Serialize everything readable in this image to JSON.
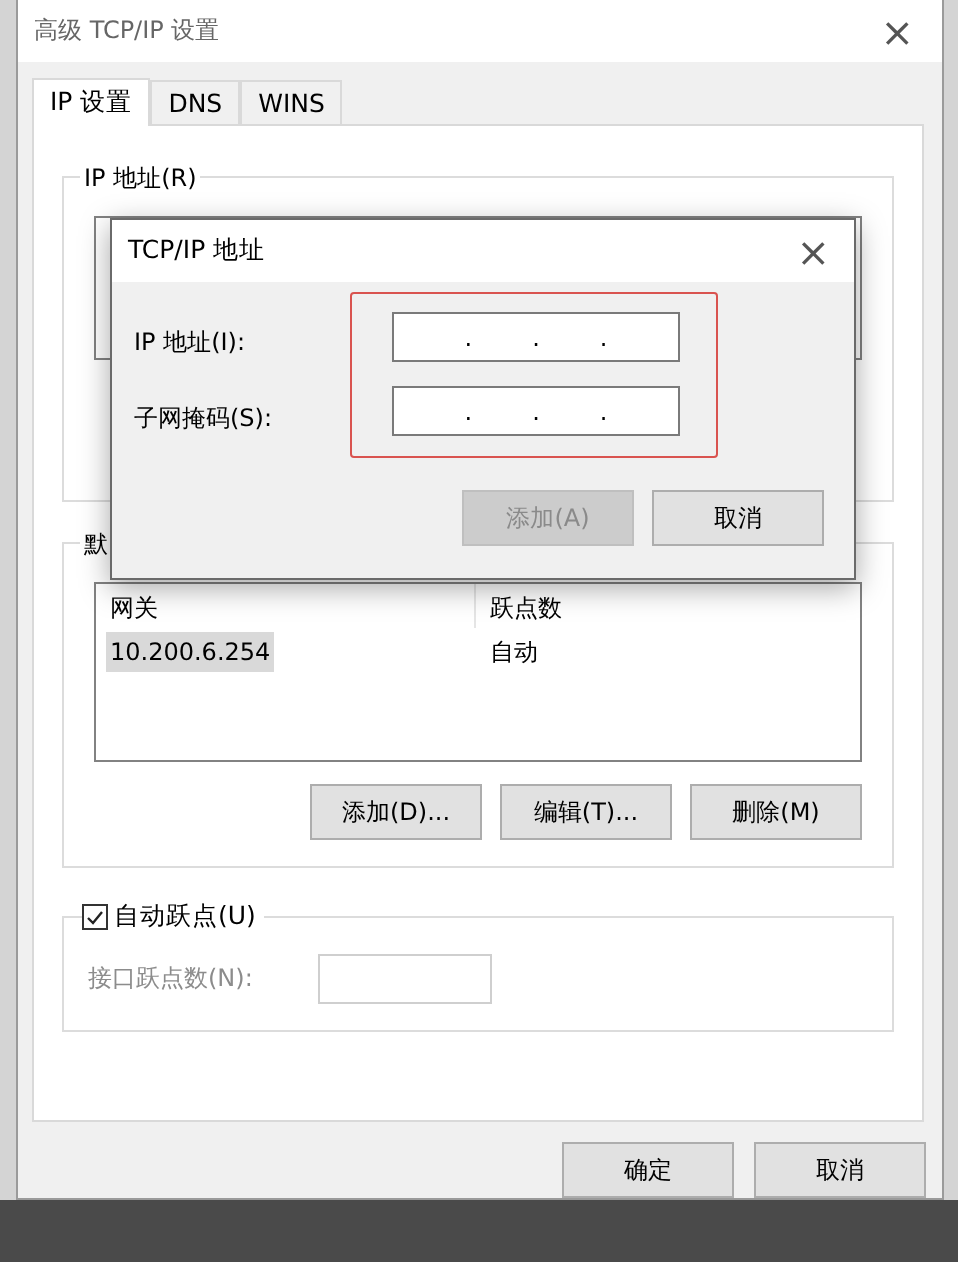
{
  "window": {
    "title": "高级 TCP/IP 设置",
    "close": "×"
  },
  "tabs": [
    {
      "label": "IP 设置",
      "selected": true
    },
    {
      "label": "DNS",
      "selected": false
    },
    {
      "label": "WINS",
      "selected": false
    }
  ],
  "ip_group": {
    "legend": "IP 地址(R)"
  },
  "gateway_group": {
    "legend": "默",
    "columns": [
      "网关",
      "跃点数"
    ],
    "rows": [
      {
        "cells": [
          "10.200.6.254",
          "自动"
        ],
        "selected": true
      }
    ],
    "buttons": [
      "添加(D)...",
      "编辑(T)...",
      "删除(M)"
    ]
  },
  "metric_group": {
    "checkbox": {
      "label": "自动跃点(U)",
      "checked": true
    },
    "field": {
      "label": "接口跃点数(N):",
      "disabled": true
    }
  },
  "footer_buttons": [
    "确定",
    "取消"
  ],
  "dialog": {
    "title": "TCP/IP 地址",
    "close": "×",
    "fields": [
      {
        "label": "IP 地址(I):",
        "separator": "."
      },
      {
        "label": "子网掩码(S):",
        "separator": "."
      }
    ],
    "buttons": [
      {
        "label": "添加(A)",
        "disabled": true
      },
      {
        "label": "取消",
        "disabled": false
      }
    ]
  }
}
